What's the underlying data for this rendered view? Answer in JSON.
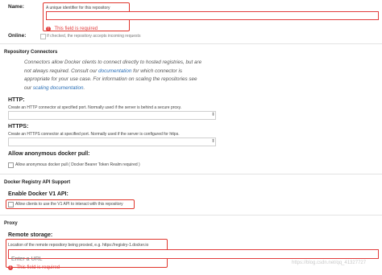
{
  "name_field": {
    "label": "Name:",
    "help": "A unique identifier for this repository",
    "value": "",
    "error": "This field is required"
  },
  "online_field": {
    "label": "Online:",
    "help": "If checked, the repository accepts incoming requests"
  },
  "repository_connectors": {
    "title": "Repository Connectors",
    "description_before": "Connectors allow Docker clients to connect directly to hosted registries, but are not always required. Consult our ",
    "documentation_link": "documentation",
    "description_middle": " for which connector is appropriate for your use case. For information on scaling the repositories see our ",
    "scaling_link": "scaling documentation",
    "description_after": ".",
    "http": {
      "label": "HTTP:",
      "help": "Create an HTTP connector at specified port. Normally used if the server is behind a secure proxy."
    },
    "https": {
      "label": "HTTPS:",
      "help": "Create an HTTPS connector at specified port. Normally used if the server is configured for https."
    },
    "anonymous": {
      "label": "Allow anonymous docker pull:",
      "help": "Allow anonymous docker pull ( Docker Bearer Token Realm required )"
    }
  },
  "docker_registry_api": {
    "title": "Docker Registry API Support",
    "v1_label": "Enable Docker V1 API:",
    "v1_help": "Allow clients to use the V1 API to interact with this repository"
  },
  "proxy": {
    "title": "Proxy",
    "remote_label": "Remote storage:",
    "remote_help": "Location of the remote repository being proxied, e.g. https://registry-1.docker.io",
    "remote_placeholder": "Enter a URL",
    "remote_error": "This field is required"
  },
  "icons": {
    "error": "exclamation-circle-icon",
    "scroll": "chevron-updown-icon"
  },
  "colors": {
    "error": "#e23c3c",
    "highlight_box": "#e0352b",
    "link": "#2a6fb7"
  },
  "watermark": "https://blog.csdn.net/qq_41327727"
}
